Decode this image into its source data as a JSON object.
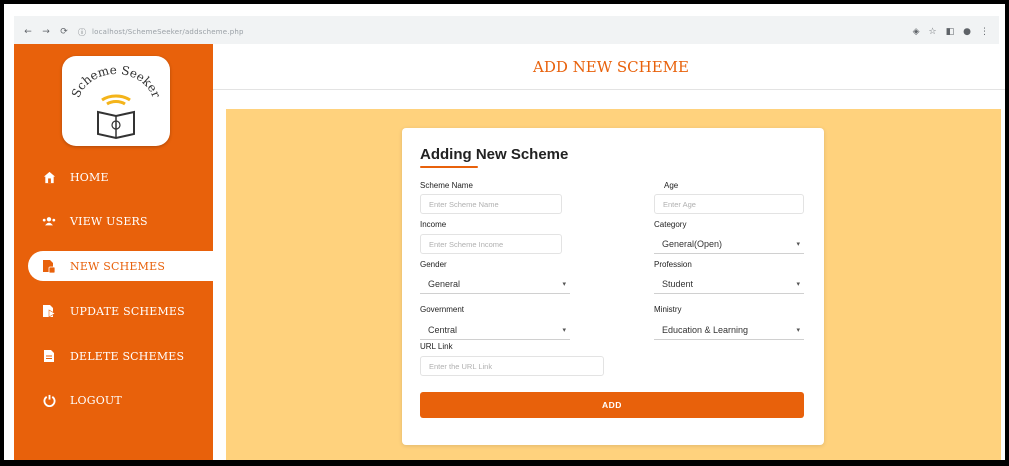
{
  "browser": {
    "url": "localhost/SchemeSeeker/addscheme.php",
    "nav_back": "←",
    "nav_forward": "→",
    "nav_reload": "⟳",
    "info_icon": "ⓘ"
  },
  "app": {
    "logo_text": "Scheme Seeker",
    "page_title": "ADD NEW SCHEME"
  },
  "sidebar": {
    "items": [
      {
        "label": "HOME",
        "icon": "home-icon"
      },
      {
        "label": "VIEW USERS",
        "icon": "users-icon"
      },
      {
        "label": "NEW SCHEMES",
        "icon": "new-scheme-icon",
        "active": true
      },
      {
        "label": "UPDATE SCHEMES",
        "icon": "update-icon"
      },
      {
        "label": "DELETE SCHEMES",
        "icon": "delete-icon"
      },
      {
        "label": "LOGOUT",
        "icon": "logout-icon"
      }
    ]
  },
  "form": {
    "title": "Adding New Scheme",
    "scheme_name": {
      "label": "Scheme Name",
      "placeholder": "Enter Scheme Name"
    },
    "age": {
      "label": "Age",
      "placeholder": "Enter Age"
    },
    "income": {
      "label": "Income",
      "placeholder": "Enter Scheme Income"
    },
    "category": {
      "label": "Category",
      "value": "General(Open)"
    },
    "gender": {
      "label": "Gender",
      "value": "General"
    },
    "profession": {
      "label": "Profession",
      "value": "Student"
    },
    "government": {
      "label": "Government",
      "value": "Central"
    },
    "ministry": {
      "label": "Ministry",
      "value": "Education & Learning"
    },
    "url": {
      "label": "URL Link",
      "placeholder": "Enter the URL Link"
    },
    "submit_label": "ADD"
  },
  "colors": {
    "accent": "#e8610b",
    "content_bg": "#ffd27d"
  }
}
